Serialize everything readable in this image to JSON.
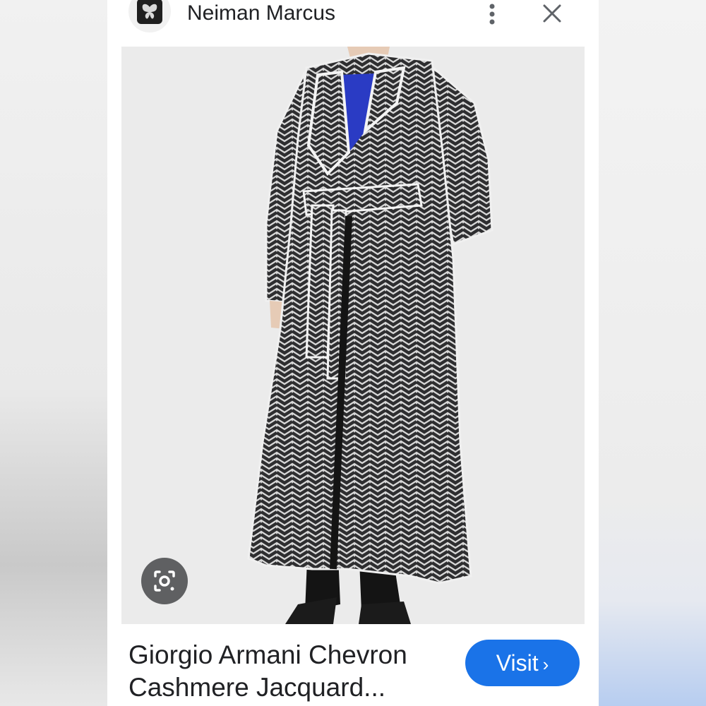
{
  "header": {
    "site_name": "Neiman Marcus",
    "favicon_icon": "butterfly-icon",
    "more_icon": "more-vert-icon",
    "close_icon": "close-icon"
  },
  "product": {
    "title": "Giorgio Armani Chevron\nCashmere Jacquard...",
    "image_alt": "Model wearing long black and white chevron jacquard wrap coat with belt"
  },
  "actions": {
    "visit_label": "Visit",
    "visit_chevron": "›",
    "lens_icon": "google-lens-icon"
  },
  "colors": {
    "accent": "#1a73e8",
    "text": "#202124",
    "coat_dark": "#2e2e30",
    "coat_light": "#dcdcdc",
    "sweater": "#2a3bc4"
  }
}
